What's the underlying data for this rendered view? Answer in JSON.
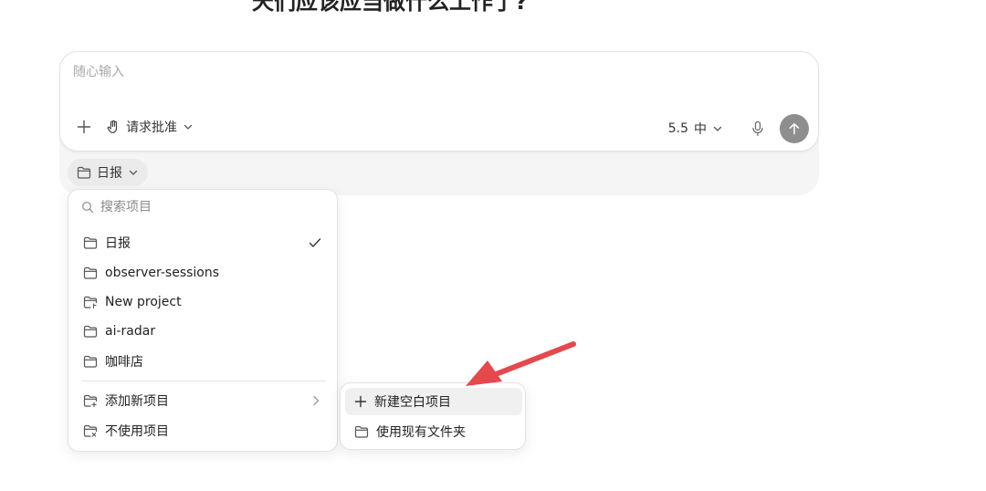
{
  "clipped_title": "天们应该应当做什么工作了?",
  "composer": {
    "placeholder": "随心输入",
    "approval_label": "请求批准",
    "model_label": "5.5",
    "effort_label": "中"
  },
  "project_chip": {
    "label": "日报"
  },
  "project_menu": {
    "search_placeholder": "搜索项目",
    "projects": [
      {
        "label": "日报",
        "icon": "folder-icon",
        "selected": true
      },
      {
        "label": "observer-sessions",
        "icon": "folder-icon",
        "selected": false
      },
      {
        "label": "New project",
        "icon": "folder-git-icon",
        "selected": false
      },
      {
        "label": "ai-radar",
        "icon": "folder-icon",
        "selected": false
      },
      {
        "label": "咖啡店",
        "icon": "folder-icon",
        "selected": false
      }
    ],
    "add_project_label": "添加新项目",
    "no_project_label": "不使用项目"
  },
  "add_submenu": {
    "items": [
      {
        "label": "新建空白项目",
        "icon": "plus-icon",
        "highlighted": true
      },
      {
        "label": "使用现有文件夹",
        "icon": "folder-icon",
        "highlighted": false
      }
    ]
  },
  "colors": {
    "send_button": "#8e8e8e",
    "annotation_arrow": "#e5484d",
    "chip_background": "#ebebeb"
  }
}
